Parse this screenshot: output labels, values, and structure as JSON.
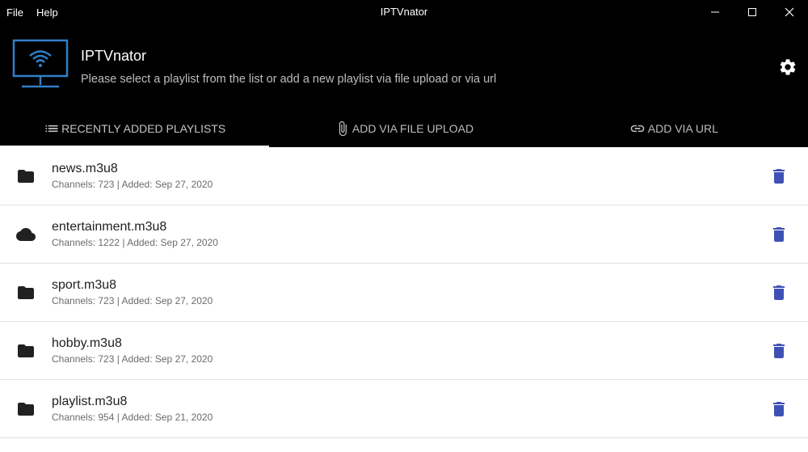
{
  "window": {
    "title": "IPTVnator",
    "menu": [
      "File",
      "Help"
    ]
  },
  "header": {
    "title": "IPTVnator",
    "subtitle": "Please select a playlist from the list or add a new playlist via file upload or via url"
  },
  "tabs": [
    {
      "label": "RECENTLY ADDED PLAYLISTS",
      "icon": "list-icon",
      "active": true
    },
    {
      "label": "ADD VIA FILE UPLOAD",
      "icon": "paperclip-icon",
      "active": false
    },
    {
      "label": "ADD VIA URL",
      "icon": "link-icon",
      "active": false
    }
  ],
  "playlists": [
    {
      "name": "news.m3u8",
      "meta": "Channels: 723 | Added: Sep 27, 2020",
      "icon": "folder-icon"
    },
    {
      "name": "entertainment.m3u8",
      "meta": "Channels: 1222 | Added: Sep 27, 2020",
      "icon": "cloud-icon"
    },
    {
      "name": "sport.m3u8",
      "meta": "Channels: 723 | Added: Sep 27, 2020",
      "icon": "folder-icon"
    },
    {
      "name": "hobby.m3u8",
      "meta": "Channels: 723 | Added: Sep 27, 2020",
      "icon": "folder-icon"
    },
    {
      "name": "playlist.m3u8",
      "meta": "Channels: 954 | Added: Sep 21, 2020",
      "icon": "folder-icon"
    }
  ],
  "colors": {
    "accent_delete": "#3f51b5",
    "logo_blue": "#2f7fc8",
    "background": "#000000"
  }
}
